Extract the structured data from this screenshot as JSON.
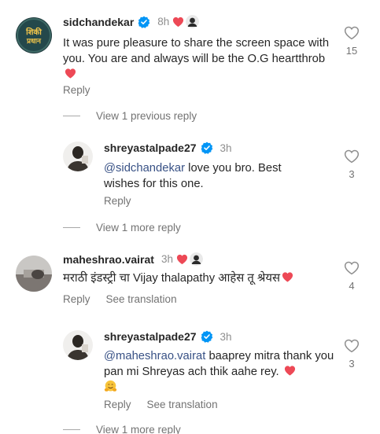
{
  "comments": [
    {
      "username": "sidchandekar",
      "time": "8h",
      "text_part1": "It was pure pleasure to share the screen space with you. You are and always will be the O.G heartthrob",
      "reply_label": "Reply",
      "like_count": "15",
      "avatar_text": "शिकी प्रधान"
    },
    {
      "username": "shreyastalpade27",
      "time": "3h",
      "mention": "@sidchandekar",
      "text_part1": " love you bro. Best wishes for this one.",
      "reply_label": "Reply",
      "like_count": "3"
    },
    {
      "username": "maheshrao.vairat",
      "time": "3h",
      "text_part1": "मराठी इंडस्ट्री चा Vijay thalapathy आहेस तू श्रेयस",
      "reply_label": "Reply",
      "see_translation": "See translation",
      "like_count": "4"
    },
    {
      "username": "shreyastalpade27",
      "time": "3h",
      "mention": "@maheshrao.vairat",
      "text_part1": " baaprey mitra thank you pan mi Shreyas ach thik aahe rey.",
      "reply_label": "Reply",
      "see_translation": "See translation",
      "like_count": "3"
    }
  ],
  "view_previous": "View 1 previous reply",
  "view_more_1": "View 1 more reply",
  "view_more_2": "View 1 more reply",
  "colors": {
    "verified": "#0095f6",
    "heart": "#ed4956",
    "mention": "#385185",
    "muted": "#737373"
  },
  "icons": {
    "verified": "verified-badge-icon",
    "heart": "red-heart-icon",
    "like": "heart-outline-icon",
    "hug": "hugging-face-emoji"
  }
}
